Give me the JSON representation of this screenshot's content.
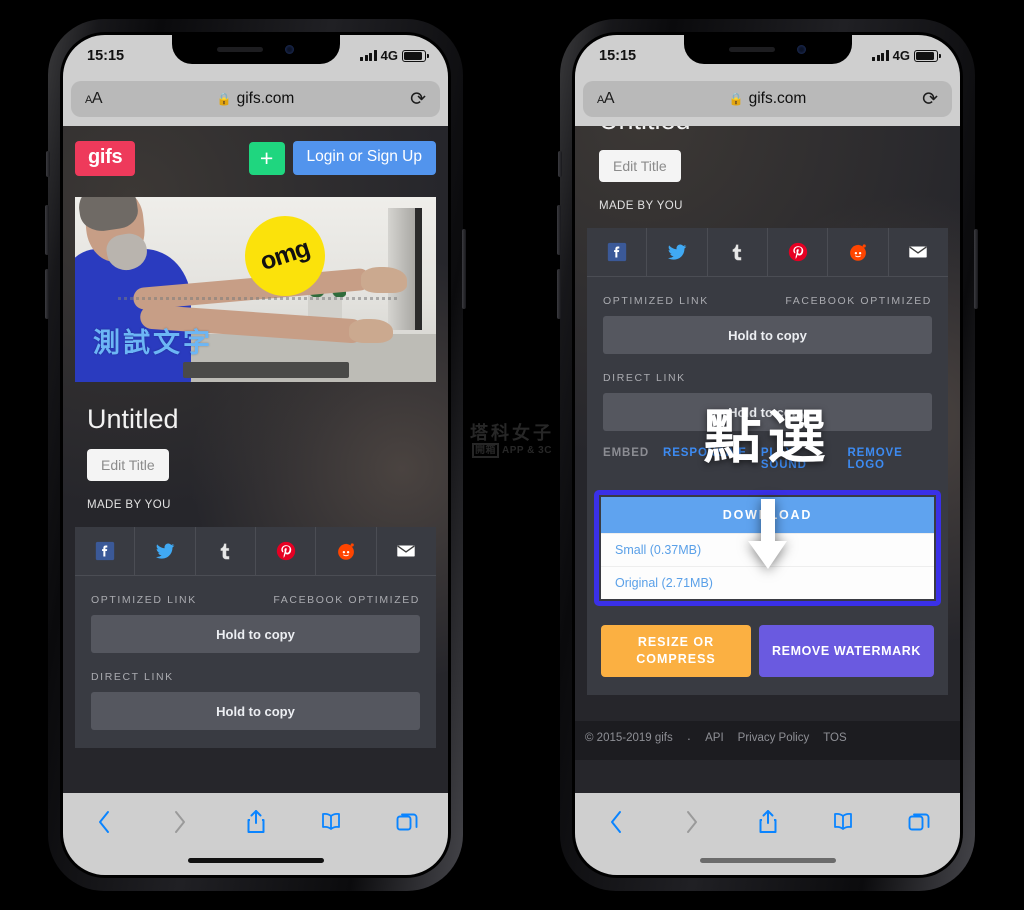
{
  "status_bar": {
    "time": "15:15",
    "network": "4G",
    "signal_bars": 4,
    "battery_pct": 88
  },
  "browser": {
    "url": "gifs.com",
    "lock_icon": "lock-icon",
    "text_size_label_small": "A",
    "text_size_label_large": "A",
    "reload_icon": "reload-icon",
    "toolbar": {
      "back": "back-chevron-icon",
      "forward": "forward-chevron-icon",
      "share": "share-icon",
      "bookmarks": "book-icon",
      "tabs": "tabs-icon"
    }
  },
  "site": {
    "logo": "gifs",
    "add_button": "+",
    "login_button": "Login or Sign Up"
  },
  "gif": {
    "overlay_sticker": "omg",
    "caption": "測試文字",
    "title": "Untitled",
    "edit_title_button": "Edit Title",
    "made_by": "MADE BY YOU"
  },
  "share": {
    "items": [
      {
        "name": "facebook",
        "label": "Facebook",
        "color": "#3b5998"
      },
      {
        "name": "twitter",
        "label": "Twitter",
        "color": "#40a9f3"
      },
      {
        "name": "tumblr",
        "label": "Tumblr",
        "color": "#e8e8e8"
      },
      {
        "name": "pinterest",
        "label": "Pinterest",
        "color": "#e60023"
      },
      {
        "name": "reddit",
        "label": "Reddit",
        "color": "#ff4500"
      },
      {
        "name": "email",
        "label": "Email",
        "color": "#ffffff"
      }
    ]
  },
  "links": {
    "optimized_label": "OPTIMIZED LINK",
    "facebook_optimized_label": "FACEBOOK OPTIMIZED",
    "direct_label": "DIRECT LINK",
    "copy_button": "Hold to copy"
  },
  "options": {
    "embed": "EMBED",
    "responsive": "RESPONSIVE",
    "play_sound": "PLAY SOUND",
    "remove_logo": "REMOVE LOGO"
  },
  "download": {
    "header": "DOWNLOAD",
    "options": [
      {
        "label": "Small (0.37MB)",
        "size": "0.37MB"
      },
      {
        "label": "Original (2.71MB)",
        "size": "2.71MB"
      }
    ],
    "highlight_color": "#3a30e8"
  },
  "actions": {
    "resize": "RESIZE OR\nCOMPRESS",
    "resize_line1": "RESIZE OR",
    "resize_line2": "COMPRESS",
    "remove_watermark": "REMOVE WATERMARK",
    "resize_color": "#fbb042",
    "watermark_color": "#6a5ae0"
  },
  "footer": {
    "copyright": "© 2015-2019 gifs",
    "dot": "·",
    "api": "API",
    "privacy": "Privacy Policy",
    "tos": "TOS"
  },
  "annotation": {
    "text": "點選",
    "arrow": "down-arrow-icon"
  },
  "watermark": {
    "line1": "塔科女子",
    "boxed": "開箱",
    "suffix": "APP & 3C"
  }
}
